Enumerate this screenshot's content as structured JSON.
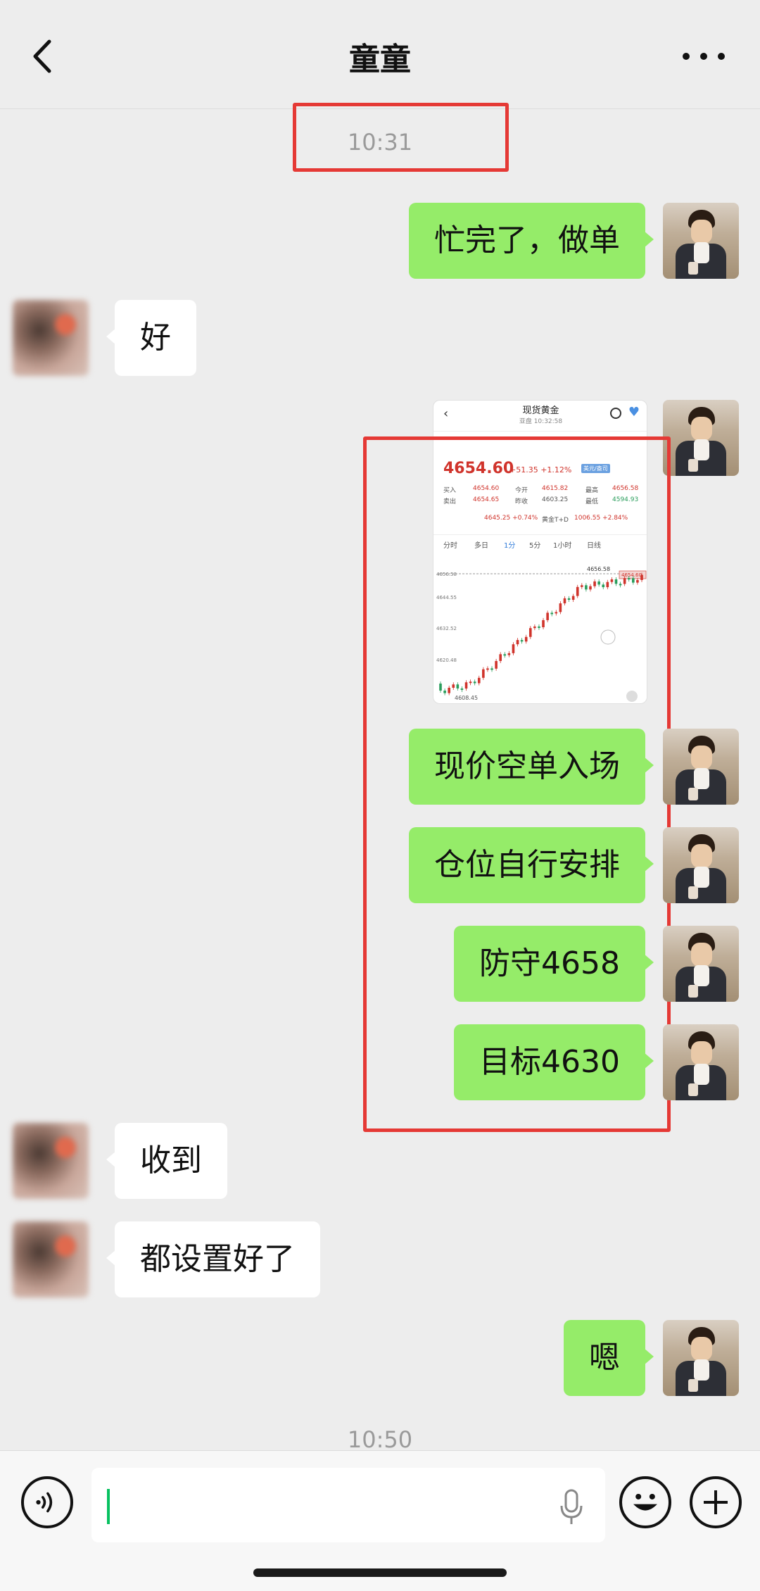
{
  "header": {
    "title": "童童"
  },
  "timestamps": [
    "10:31",
    "10:50"
  ],
  "messages": [
    {
      "from": "me",
      "text": "忙完了，做单"
    },
    {
      "from": "other",
      "text": "好"
    },
    {
      "from": "me",
      "type": "image"
    },
    {
      "from": "me",
      "text": "现价空单入场"
    },
    {
      "from": "me",
      "text": "仓位自行安排"
    },
    {
      "from": "me",
      "text": "防守4658"
    },
    {
      "from": "me",
      "text": "目标4630"
    },
    {
      "from": "other",
      "text": "收到"
    },
    {
      "from": "other",
      "text": "都设置好了"
    },
    {
      "from": "me",
      "text": "嗯"
    }
  ],
  "shot": {
    "title": "现货黄金",
    "subtitle": "亚盘 10:32:58",
    "price": "4654.60",
    "change": "+51.35 +1.12%",
    "badge": "美元/盎司",
    "row1": {
      "l1": "买入",
      "v1": "4654.60",
      "l2": "今开",
      "v2": "4615.82",
      "l3": "最高",
      "v3": "4656.58"
    },
    "row2": {
      "l1": "卖出",
      "v1": "4654.65",
      "l2": "昨收",
      "v2": "4603.25",
      "l3": "最低",
      "v3": "4594.93"
    },
    "row3": {
      "a": "4645.25 +0.74%",
      "b": "黄金T+D",
      "c": "1006.55 +2.84%"
    },
    "tabs": [
      "分时",
      "多日",
      "1分",
      "5分",
      "1小时",
      "日线"
    ],
    "price_labels": [
      "4656.58",
      "4644.55",
      "4632.52",
      "4620.48",
      "4608.45"
    ],
    "last_label": "4654.60",
    "high_label": "4656.58"
  },
  "colors": {
    "bubble_me": "#95ec69",
    "bubble_other": "#ffffff",
    "annotation": "#e53935",
    "up": "#d0342c",
    "down": "#2a9d5c"
  },
  "icons": [
    "chevron-left-icon",
    "more-dots-icon",
    "voice-icon",
    "mic-icon",
    "emoji-icon",
    "plus-icon"
  ]
}
